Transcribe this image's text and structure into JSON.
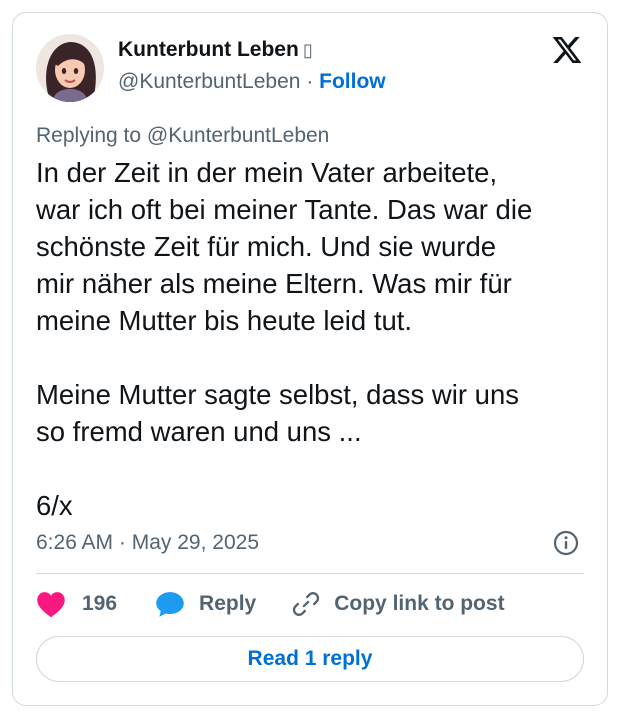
{
  "author": {
    "name": "Kunterbunt Leben",
    "name_badge": "▯",
    "handle": "@KunterbuntLeben",
    "separator": "·",
    "follow_label": "Follow",
    "avatar_icon": "cartoon-woman-avatar"
  },
  "platform_icon": "x-logo-icon",
  "reply_context": "Replying to @KunterbuntLeben",
  "body": {
    "paragraph1": "In der Zeit in der mein Vater arbeitete,\nwar ich oft bei meiner Tante. Das war die\nschönste Zeit für mich. Und sie wurde\nmir näher als meine Eltern. Was mir für\nmeine Mutter bis heute leid tut.",
    "paragraph2": "Meine Mutter sagte selbst, dass wir uns\nso fremd waren und uns ...",
    "paragraph3": "6/x"
  },
  "meta": {
    "time": "6:26 AM",
    "separator": "·",
    "date": "May 29, 2025"
  },
  "actions": {
    "like_count": "196",
    "reply_label": "Reply",
    "copy_label": "Copy link to post"
  },
  "read_replies_label": "Read 1 reply",
  "colors": {
    "like": "#f91880",
    "reply": "#1d9bf0",
    "link": "#006fd6",
    "muted": "#536471",
    "border": "#cfd9de"
  }
}
